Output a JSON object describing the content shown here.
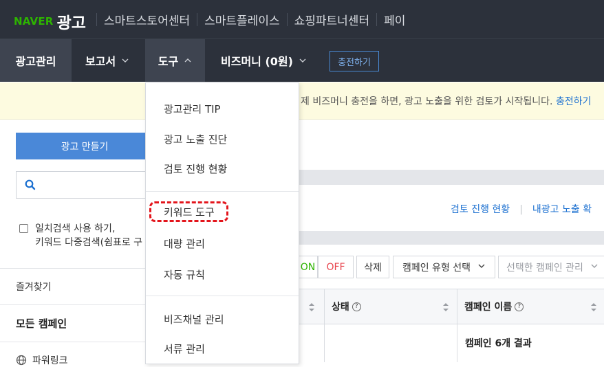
{
  "brand": {
    "naver": "NAVER",
    "ad": "광고"
  },
  "top_nav": [
    "스마트스토어센터",
    "스마트플레이스",
    "쇼핑파트너센터",
    "페이"
  ],
  "main_nav": {
    "ad_manage": "광고관리",
    "report": "보고서",
    "tools": "도구",
    "biz_money": "비즈머니 (0원)",
    "charge": "충전하기"
  },
  "notice": {
    "text": "제 비즈머니 충전을 하면, 광고 노출을 위한 검토가 시작됩니다. ",
    "link": "충전하기"
  },
  "sidebar": {
    "create_button": "광고 만들기",
    "search_placeholder": "",
    "exact_match_line1": "일치검색 사용 하기,",
    "exact_match_line2": "키워드 다중검색(쉼표로 구",
    "favorites": "즐겨찾기",
    "all_campaigns": "모든 캠페인",
    "powerlink": "파워링크"
  },
  "tools_menu": {
    "items_group1": [
      "광고관리 TIP",
      "광고 노출 진단",
      "검토 진행 현황"
    ],
    "items_group2": [
      "키워드 도구",
      "대량 관리",
      "자동 규칙"
    ],
    "items_group3": [
      "비즈채널 관리",
      "서류 관리"
    ],
    "highlighted": "키워드 도구"
  },
  "main": {
    "link_review": "검토 진행 현황",
    "link_exposure": "내광고 노출 확",
    "toolbar": {
      "on": "ON",
      "off": "OFF",
      "delete": "삭제",
      "campaign_type": "캠페인 유형 선택",
      "selected_manage": "선택한 캠페인 관리"
    },
    "columns": {
      "status": "상태",
      "campaign_name": "캠페인 이름"
    },
    "result": "캠페인 6개 결과"
  },
  "colors": {
    "naver_green": "#2db400",
    "nav_bg": "#2c313b",
    "link_blue": "#1a6fd0",
    "highlight_red": "#e3151c"
  }
}
